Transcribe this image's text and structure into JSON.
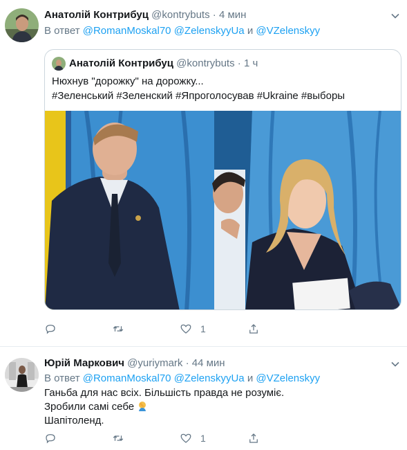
{
  "tweet1": {
    "author_name": "Анатолій Контрибуц",
    "author_handle": "@kontrybuts",
    "dot": "·",
    "time": "4 мин",
    "reply_prefix": "В ответ",
    "mention1": "@RomanMoskal70",
    "mention2": "@ZelenskyyUa",
    "and_word": "и",
    "mention3": "@VZelenskyy",
    "like_count": "1",
    "quote": {
      "author_name": "Анатолій Контрибуц",
      "author_handle": "@kontrybuts",
      "dot": "·",
      "time": "1 ч",
      "text_line1": "Нюхнув \"дорожку\" на дорожку...",
      "text_line2": "#Зеленський #Зеленский #Япроголосував #Ukraine #выборы"
    }
  },
  "tweet2": {
    "author_name": "Юрій Маркович",
    "author_handle": "@yuriymark",
    "dot": "·",
    "time": "44 мин",
    "reply_prefix": "В ответ",
    "mention1": "@RomanMoskal70",
    "mention2": "@ZelenskyyUa",
    "and_word": "и",
    "mention3": "@VZelenskyy",
    "text_line1": "Ганьба для нас всіх. Більшість правда не розуміє.",
    "text_line2": "Зробили самі себе",
    "text_line3": "Шапітоленд.",
    "like_count": "1"
  },
  "icons": {
    "reply": "reply-icon",
    "retweet": "retweet-icon",
    "like": "heart-icon",
    "share": "share-icon",
    "more": "chevron-down-icon",
    "facepalm": "facepalm-emoji-icon"
  },
  "colors": {
    "link": "#1da1f2",
    "secondary": "#657786",
    "border": "#e6ecf0"
  }
}
